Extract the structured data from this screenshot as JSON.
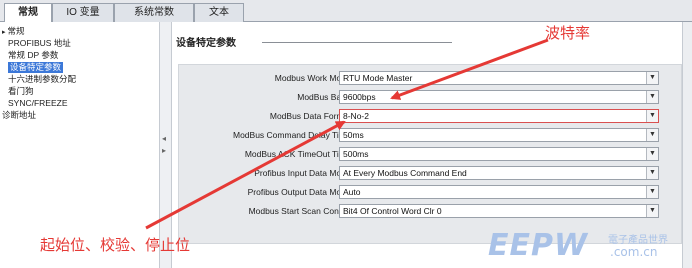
{
  "tabs": [
    {
      "label": "常规",
      "active": true
    },
    {
      "label": "IO 变量",
      "active": false
    },
    {
      "label": "系统常数",
      "active": false
    },
    {
      "label": "文本",
      "active": false
    }
  ],
  "sidebar": {
    "items": [
      {
        "label": "常规",
        "root": true
      },
      {
        "label": "PROFIBUS 地址"
      },
      {
        "label": "常规 DP 参数"
      },
      {
        "label": "设备特定参数",
        "selected": true
      },
      {
        "label": "十六进制参数分配"
      },
      {
        "label": "看门狗"
      },
      {
        "label": "SYNC/FREEZE"
      },
      {
        "label": "诊断地址",
        "root": true
      }
    ]
  },
  "section": {
    "title": "设备特定参数"
  },
  "params": [
    {
      "label": "Modbus Work Mode:",
      "value": "RTU Mode Master"
    },
    {
      "label": "ModBus Baud:",
      "value": "9600bps"
    },
    {
      "label": "ModBus Data Format:",
      "value": "8-No-2"
    },
    {
      "label": "ModBus Command Delay Time:",
      "value": "50ms"
    },
    {
      "label": "ModBus ACK TimeOut Time:",
      "value": "500ms"
    },
    {
      "label": "Profibus Input Data Mode:",
      "value": "At Every Modbus Command End"
    },
    {
      "label": "Profibus Output Data Mode:",
      "value": "Auto"
    },
    {
      "label": "Modbus Start Scan Control:",
      "value": "Bit4 Of Control Word Clr 0"
    }
  ],
  "annotations": {
    "baud_rate": "波特率",
    "data_bits": "起始位、校验、停止位"
  },
  "watermark": {
    "logo": "EEPW",
    "subtitle": "電子產品世界",
    "domain": ".com.cn"
  },
  "colors": {
    "annotation": "#e53935",
    "selection": "#3c78d8",
    "watermark": "#a9c2e8"
  }
}
